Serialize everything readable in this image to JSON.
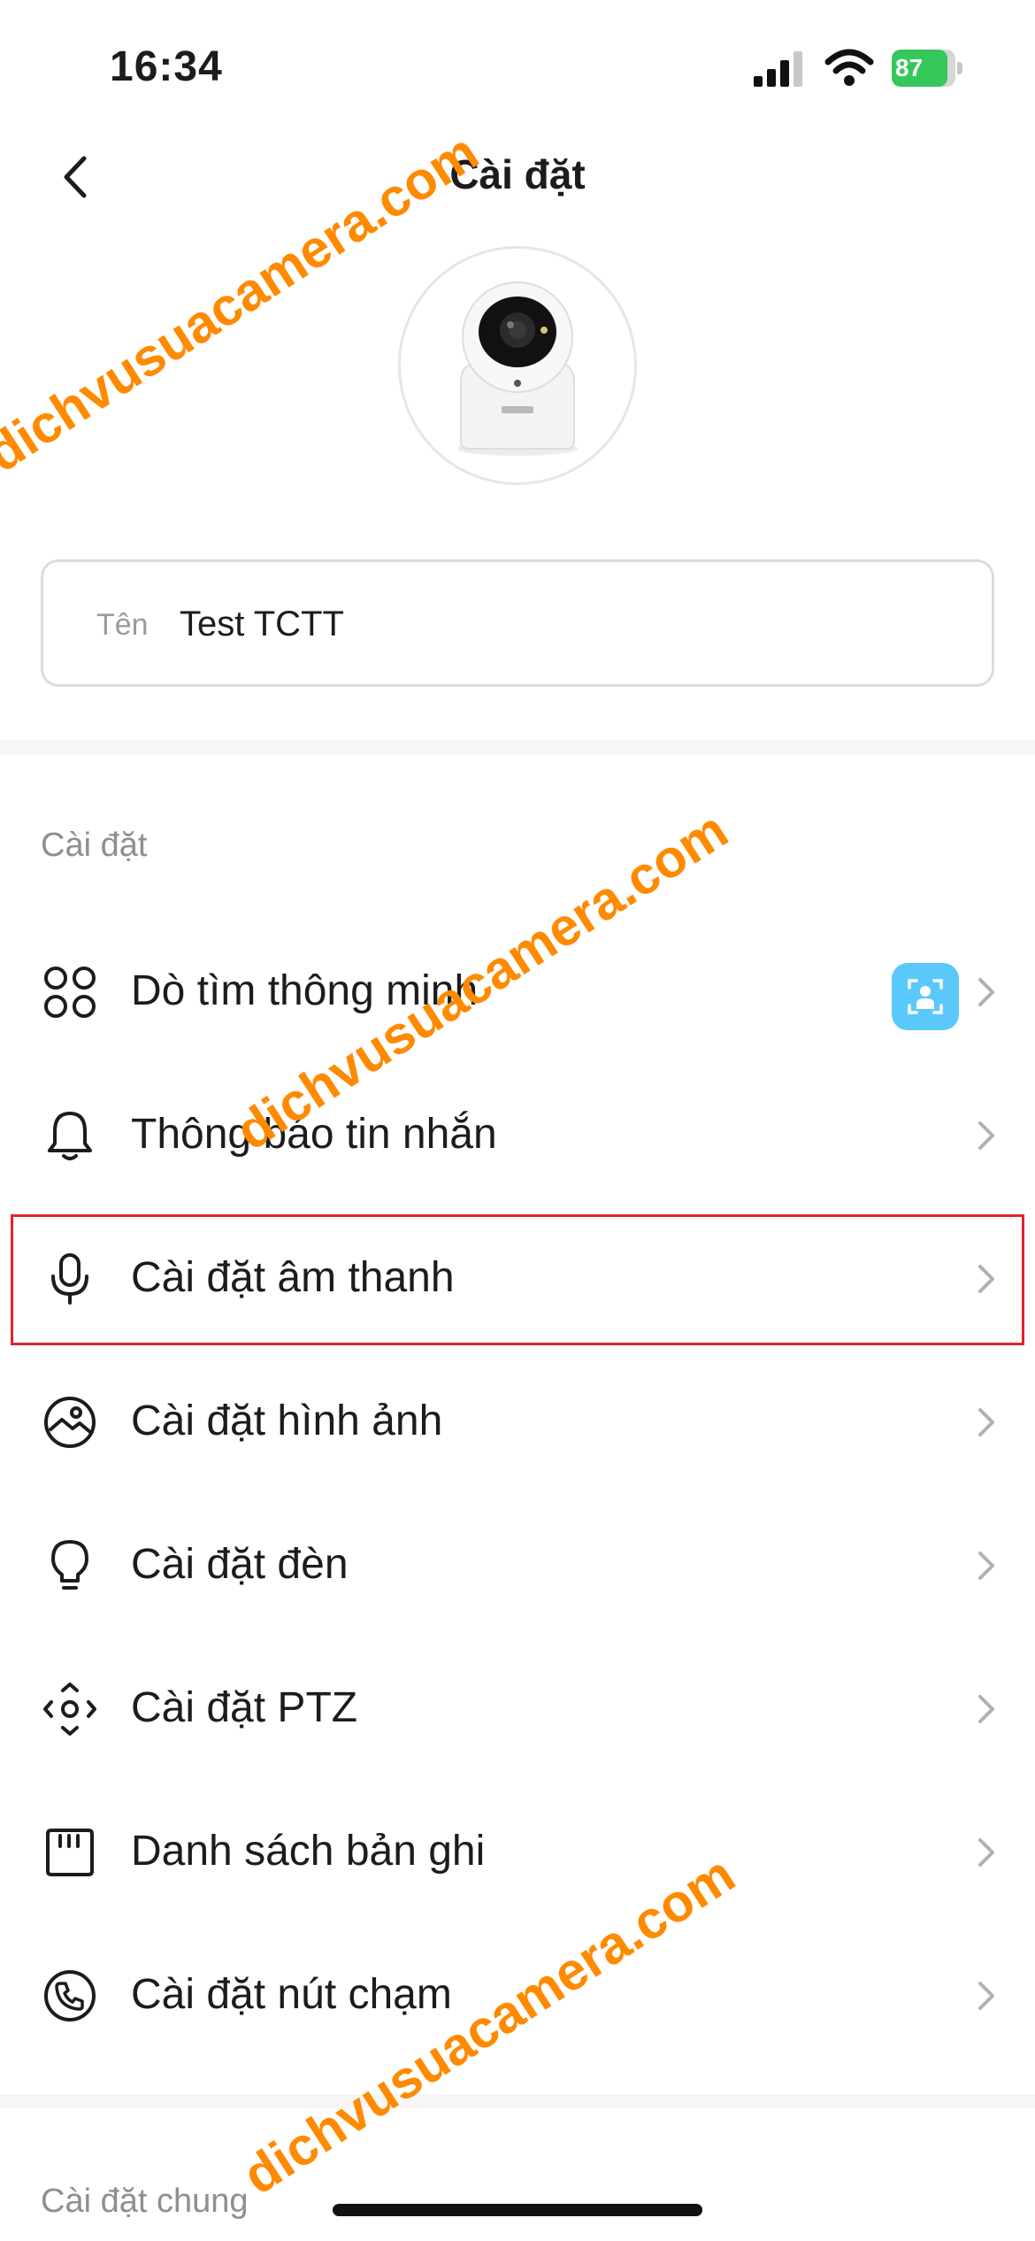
{
  "status_bar": {
    "time": "16:34",
    "battery": {
      "text": "87",
      "level_percent": 87
    },
    "icons": [
      "cellular-signal-icon",
      "wifi-icon",
      "battery-charging-icon"
    ]
  },
  "nav": {
    "title": "Cài đặt",
    "back_icon": "chevron-left-icon"
  },
  "device": {
    "image_icon": "ezviz-camera-image",
    "name_label": "Tên",
    "name_value": "Test TCTT"
  },
  "sections": [
    {
      "title": "Cài đặt",
      "items": [
        {
          "label": "Dò tìm thông minh",
          "icon": "apps-grid-icon",
          "badge_icon": "person-detection-icon"
        },
        {
          "label": "Thông báo tin nhắn",
          "icon": "bell-icon"
        },
        {
          "label": "Cài đặt âm thanh",
          "icon": "microphone-icon",
          "highlighted": true
        },
        {
          "label": "Cài đặt hình ảnh",
          "icon": "image-icon"
        },
        {
          "label": "Cài đặt đèn",
          "icon": "lightbulb-icon"
        },
        {
          "label": "Cài đặt PTZ",
          "icon": "ptz-icon"
        },
        {
          "label": "Danh sách bản ghi",
          "icon": "sd-card-icon"
        },
        {
          "label": "Cài đặt nút chạm",
          "icon": "phone-icon"
        }
      ]
    },
    {
      "title": "Cài đặt chung"
    }
  ],
  "watermarks": [
    "dichvusuacamera.com",
    "dichvusuacamera.com",
    "dichvusuacamera.com"
  ],
  "colors": {
    "accent_badge": "#5ac8fa",
    "highlight_border": "#e0242c",
    "watermark": "#ff8a00",
    "battery_green": "#34c759"
  }
}
